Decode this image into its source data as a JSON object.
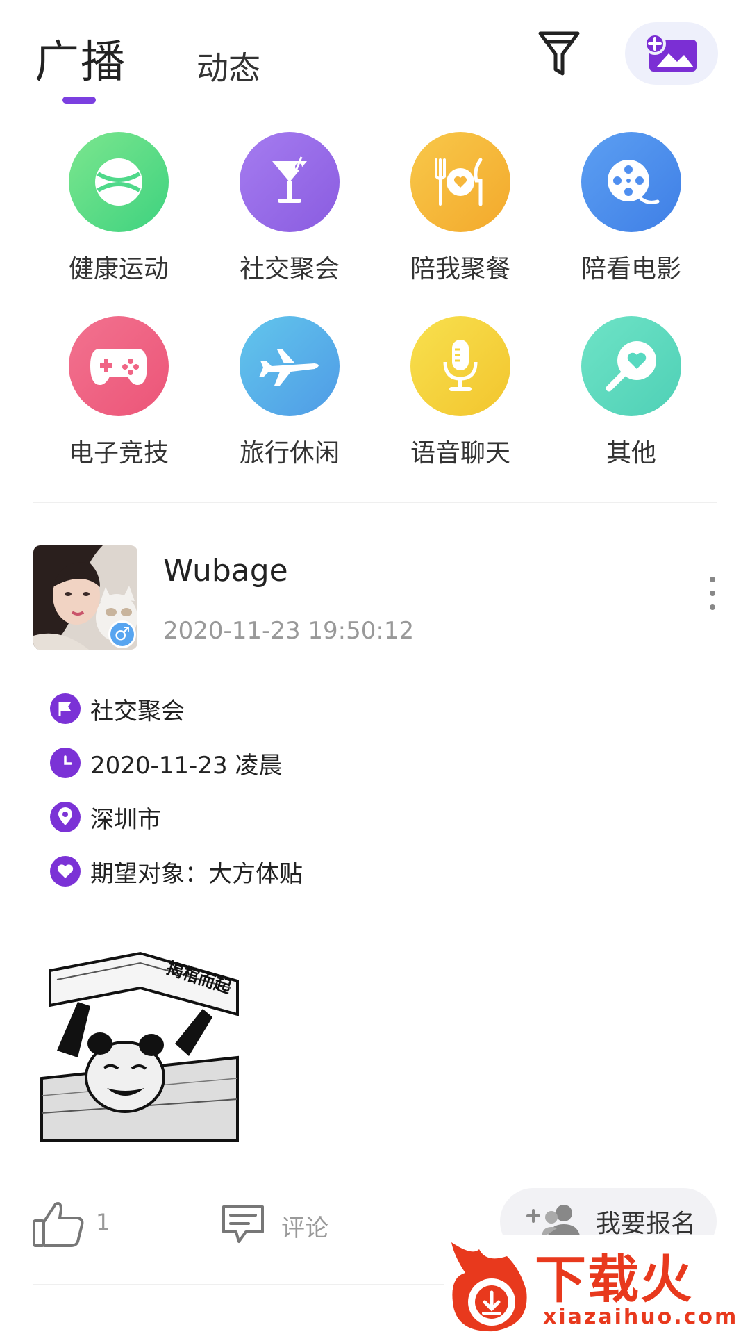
{
  "header": {
    "tab_active": "广播",
    "tab_inactive": "动态"
  },
  "categories": [
    {
      "label": "健康运动",
      "icon": "tennis-ball-icon",
      "color": "#4fd98a"
    },
    {
      "label": "社交聚会",
      "icon": "cocktail-icon",
      "color": "#9b6ce8"
    },
    {
      "label": "陪我聚餐",
      "icon": "dining-icon",
      "color": "#f6b73c"
    },
    {
      "label": "陪看电影",
      "icon": "film-reel-icon",
      "color": "#4f8ff0"
    },
    {
      "label": "电子竞技",
      "icon": "gamepad-icon",
      "color": "#f06585"
    },
    {
      "label": "旅行休闲",
      "icon": "airplane-icon",
      "color": "#58aee8"
    },
    {
      "label": "语音聊天",
      "icon": "microphone-icon",
      "color": "#f6d43b"
    },
    {
      "label": "其他",
      "icon": "search-heart-icon",
      "color": "#57d9c0"
    }
  ],
  "post": {
    "username": "Wubage",
    "timestamp": "2020-11-23 19:50:12",
    "gender_symbol": "♂",
    "category": "社交聚会",
    "event_time": "2020-11-23 凌晨",
    "location": "深圳市",
    "expectation": "期望对象：大方体贴",
    "meme_caption": "揭棺而起",
    "likes": "1",
    "comment_label": "评论",
    "signup_label": "我要报名"
  },
  "watermark": {
    "brand": "下载火",
    "url": "xiazaihuo.com"
  },
  "colors": {
    "accent": "#7b3fe0",
    "info_icon_bg": "#7b32d6"
  }
}
